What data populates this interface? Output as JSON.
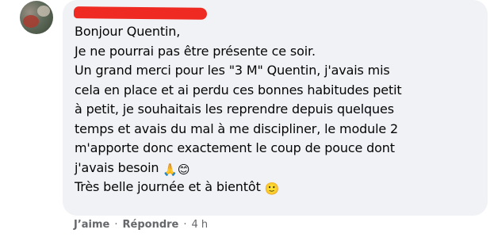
{
  "comment": {
    "author_name": "",
    "lines": [
      "Bonjour Quentin,",
      "Je ne pourrai pas être présente ce soir.",
      "Un grand merci pour les \"3 M\" Quentin, j'avais mis",
      "cela en place et ai perdu ces bonnes habitudes petit",
      "à petit, je souhaitais les reprendre depuis quelques",
      "temps et avais du mal à me discipliner, le module 2",
      "m'apporte donc exactement le coup de pouce dont",
      "j'avais besoin",
      "Très belle journée et à bientôt"
    ],
    "emojis": {
      "praying_hands": "🙏",
      "smiling_blush": "😊",
      "slight_smile": "🙂"
    }
  },
  "footer": {
    "like_label": "J’aime",
    "separator": "·",
    "reply_label": "Répondre",
    "timestamp": "4 h"
  },
  "colors": {
    "bubble_bg": "#f0f2f5",
    "text": "#050505",
    "meta_text": "#65676b",
    "redaction": "#ee2a22"
  }
}
